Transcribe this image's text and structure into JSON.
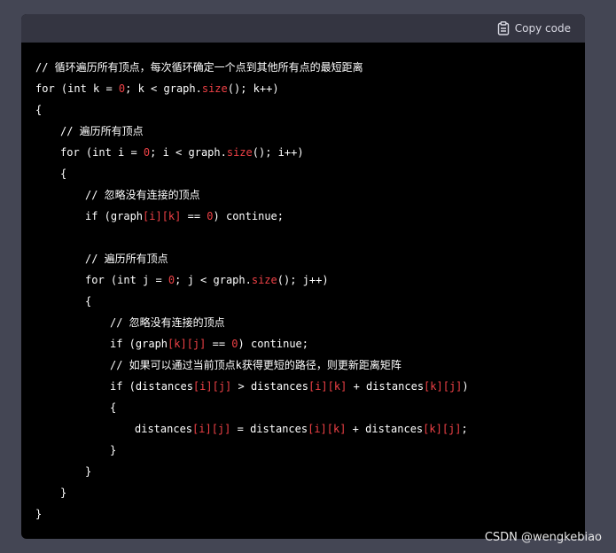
{
  "header": {
    "copy_label": "Copy code",
    "copy_icon": "clipboard-icon"
  },
  "code": [
    {
      "indent": 0,
      "tokens": [
        {
          "t": "// 循环遍历所有顶点，每次循环确定一个点到其他所有点的最短距离",
          "c": "comment"
        }
      ]
    },
    {
      "indent": 0,
      "tokens": [
        {
          "t": "for (int k = ",
          "c": "plain"
        },
        {
          "t": "0",
          "c": "red"
        },
        {
          "t": "; k < graph.",
          "c": "plain"
        },
        {
          "t": "size",
          "c": "red"
        },
        {
          "t": "(); k++)",
          "c": "plain"
        }
      ]
    },
    {
      "indent": 0,
      "tokens": [
        {
          "t": "{",
          "c": "plain"
        }
      ]
    },
    {
      "indent": 1,
      "tokens": [
        {
          "t": "// 遍历所有顶点",
          "c": "comment"
        }
      ]
    },
    {
      "indent": 1,
      "tokens": [
        {
          "t": "for (int i = ",
          "c": "plain"
        },
        {
          "t": "0",
          "c": "red"
        },
        {
          "t": "; i < graph.",
          "c": "plain"
        },
        {
          "t": "size",
          "c": "red"
        },
        {
          "t": "(); i++)",
          "c": "plain"
        }
      ]
    },
    {
      "indent": 1,
      "tokens": [
        {
          "t": "{",
          "c": "plain"
        }
      ]
    },
    {
      "indent": 2,
      "tokens": [
        {
          "t": "// 忽略没有连接的顶点",
          "c": "comment"
        }
      ]
    },
    {
      "indent": 2,
      "tokens": [
        {
          "t": "if (graph",
          "c": "plain"
        },
        {
          "t": "[i][k]",
          "c": "red"
        },
        {
          "t": " == ",
          "c": "plain"
        },
        {
          "t": "0",
          "c": "red"
        },
        {
          "t": ") continue;",
          "c": "plain"
        }
      ]
    },
    {
      "indent": 0,
      "tokens": [
        {
          "t": "",
          "c": "plain"
        }
      ]
    },
    {
      "indent": 2,
      "tokens": [
        {
          "t": "// 遍历所有顶点",
          "c": "comment"
        }
      ]
    },
    {
      "indent": 2,
      "tokens": [
        {
          "t": "for (int j = ",
          "c": "plain"
        },
        {
          "t": "0",
          "c": "red"
        },
        {
          "t": "; j < graph.",
          "c": "plain"
        },
        {
          "t": "size",
          "c": "red"
        },
        {
          "t": "(); j++)",
          "c": "plain"
        }
      ]
    },
    {
      "indent": 2,
      "tokens": [
        {
          "t": "{",
          "c": "plain"
        }
      ]
    },
    {
      "indent": 3,
      "tokens": [
        {
          "t": "// 忽略没有连接的顶点",
          "c": "comment"
        }
      ]
    },
    {
      "indent": 3,
      "tokens": [
        {
          "t": "if (graph",
          "c": "plain"
        },
        {
          "t": "[k][j]",
          "c": "red"
        },
        {
          "t": " == ",
          "c": "plain"
        },
        {
          "t": "0",
          "c": "red"
        },
        {
          "t": ") continue;",
          "c": "plain"
        }
      ]
    },
    {
      "indent": 3,
      "tokens": [
        {
          "t": "// 如果可以通过当前顶点k获得更短的路径，则更新距离矩阵",
          "c": "comment"
        }
      ]
    },
    {
      "indent": 3,
      "tokens": [
        {
          "t": "if (distances",
          "c": "plain"
        },
        {
          "t": "[i][j]",
          "c": "red"
        },
        {
          "t": " > distances",
          "c": "plain"
        },
        {
          "t": "[i][k]",
          "c": "red"
        },
        {
          "t": " + distances",
          "c": "plain"
        },
        {
          "t": "[k][j]",
          "c": "red"
        },
        {
          "t": ")",
          "c": "plain"
        }
      ]
    },
    {
      "indent": 3,
      "tokens": [
        {
          "t": "{",
          "c": "plain"
        }
      ]
    },
    {
      "indent": 4,
      "tokens": [
        {
          "t": "distances",
          "c": "plain"
        },
        {
          "t": "[i][j]",
          "c": "red"
        },
        {
          "t": " = distances",
          "c": "plain"
        },
        {
          "t": "[i][k]",
          "c": "red"
        },
        {
          "t": " + distances",
          "c": "plain"
        },
        {
          "t": "[k][j]",
          "c": "red"
        },
        {
          "t": ";",
          "c": "plain"
        }
      ]
    },
    {
      "indent": 3,
      "tokens": [
        {
          "t": "}",
          "c": "plain"
        }
      ]
    },
    {
      "indent": 2,
      "tokens": [
        {
          "t": "}",
          "c": "plain"
        }
      ]
    },
    {
      "indent": 1,
      "tokens": [
        {
          "t": "}",
          "c": "plain"
        }
      ]
    },
    {
      "indent": 0,
      "tokens": [
        {
          "t": "}",
          "c": "plain"
        }
      ]
    }
  ],
  "watermark": "CSDN @wengkebiao",
  "colors": {
    "page_bg": "#444654",
    "code_bg": "#000000",
    "header_bg": "#343541",
    "text": "#ffffff",
    "highlight": "#ef4146"
  }
}
